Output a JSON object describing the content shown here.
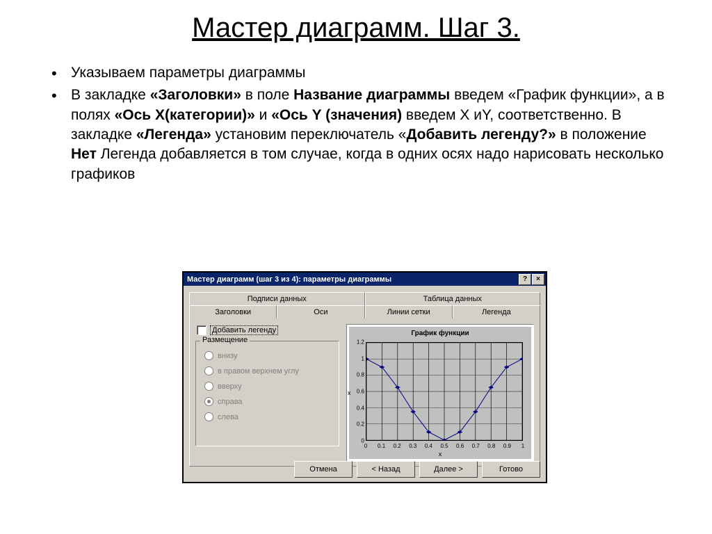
{
  "slide": {
    "title": "Мастер диаграмм. Шаг 3.",
    "bullet1": "Указываем параметры диаграммы",
    "para": {
      "t1": "В закладке ",
      "b1": "«Заголовки»",
      "t2": " в поле ",
      "b2": "Название диаграммы",
      "t3": " введем «График функции», а в полях ",
      "b3": "«Ось Х(категории)»",
      "t4": " и ",
      "b4": "«Ось Y (значения)",
      "t5": " введем  X иY, соответственно.  В закладке ",
      "b5": "«Легенда»",
      "t6": " установим переключатель «",
      "b6": "Добавить легенду?»",
      "t7": "  в положение ",
      "b7": "Нет",
      "t8": "  Легенда добавляется в том случае, когда в одних осях надо нарисовать несколько графиков"
    }
  },
  "wizard": {
    "title": "Мастер диаграмм (шаг 3 из 4): параметры диаграммы",
    "tabs_top": [
      "Подписи данных",
      "Таблица данных"
    ],
    "tabs_bot": [
      "Заголовки",
      "Оси",
      "Линии сетки",
      "Легенда"
    ],
    "checkbox": "Добавить легенду",
    "group": "Размещение",
    "radios": [
      "внизу",
      "в правом верхнем углу",
      "вверху",
      "справа",
      "слева"
    ],
    "selected_radio": 3,
    "buttons": {
      "cancel": "Отмена",
      "back": "< Назад",
      "next": "Далее >",
      "finish": "Готово"
    },
    "help": "?",
    "close": "×"
  },
  "chart_data": {
    "type": "line",
    "title": "График функции",
    "xlabel": "x",
    "ylabel": "x",
    "xlim": [
      0,
      1
    ],
    "ylim": [
      0,
      1.2
    ],
    "xticks": [
      0,
      0.1,
      0.2,
      0.3,
      0.4,
      0.5,
      0.6,
      0.7,
      0.8,
      0.9,
      1
    ],
    "yticks": [
      0,
      0.2,
      0.4,
      0.6,
      0.8,
      1,
      1.2
    ],
    "x": [
      0,
      0.1,
      0.2,
      0.3,
      0.4,
      0.5,
      0.6,
      0.7,
      0.8,
      0.9,
      1
    ],
    "values": [
      1,
      0.9,
      0.65,
      0.35,
      0.1,
      0,
      0.1,
      0.35,
      0.65,
      0.9,
      1
    ]
  }
}
